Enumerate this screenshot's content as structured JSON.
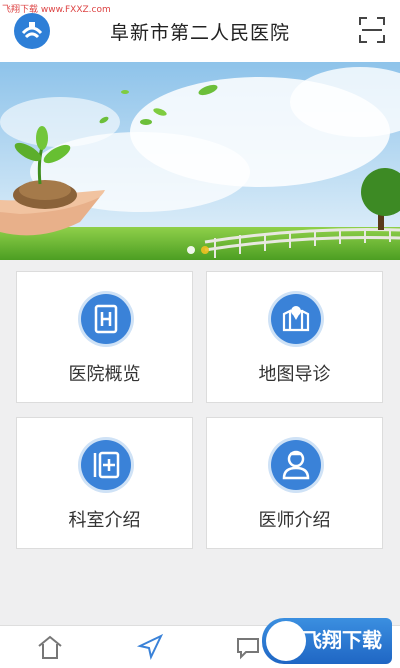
{
  "watermark": "飞翔下载 www.FXXZ.com",
  "header": {
    "title": "阜新市第二人民医院"
  },
  "banner": {
    "slides": 2,
    "active_index": 1
  },
  "cards": [
    {
      "label": "医院概览",
      "icon": "hospital-icon"
    },
    {
      "label": "地图导诊",
      "icon": "map-icon"
    },
    {
      "label": "科室介绍",
      "icon": "department-icon"
    },
    {
      "label": "医师介绍",
      "icon": "doctor-icon"
    }
  ],
  "tabbar": {
    "icons": [
      "home-icon",
      "navigation-icon",
      "chat-icon"
    ]
  },
  "promo": {
    "text": "飞翔下载"
  },
  "colors": {
    "accent": "#3a82d8",
    "header_bg": "#ffffff",
    "page_bg": "#efeff0"
  }
}
